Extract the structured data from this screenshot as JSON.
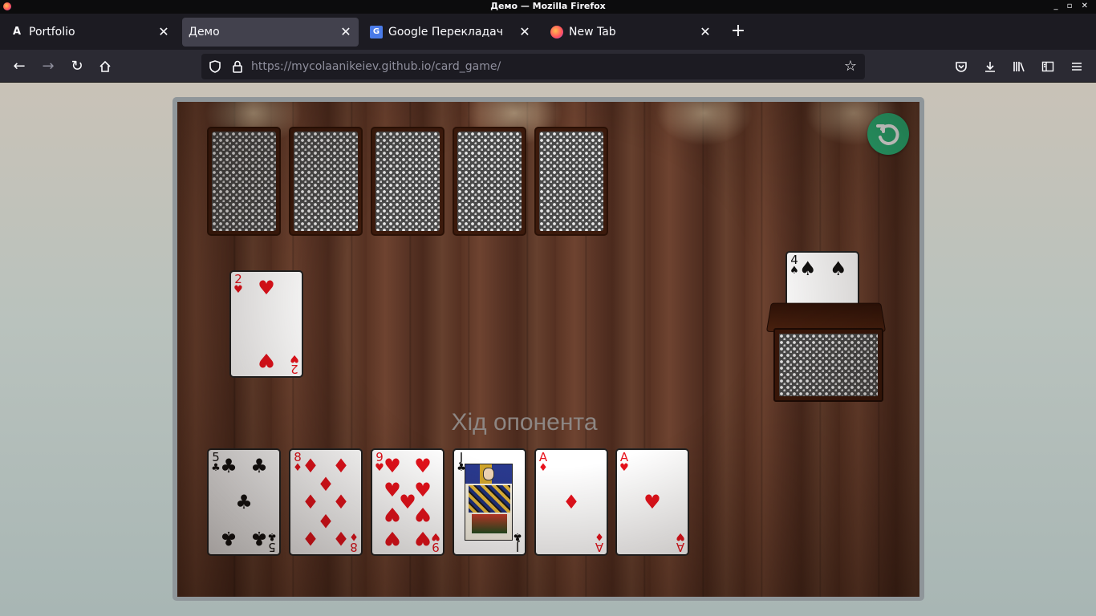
{
  "window": {
    "title": "Демо — Mozilla Firefox",
    "controls": "_ ▫ ✕"
  },
  "tabs": [
    {
      "label": "Portfolio",
      "icon": "a-logo-icon",
      "glyph": "A",
      "active": false
    },
    {
      "label": "Демо",
      "icon": "none",
      "glyph": "",
      "active": true
    },
    {
      "label": "Google Перекладач",
      "icon": "google-translate-icon",
      "glyph": "G",
      "active": false
    },
    {
      "label": "New Tab",
      "icon": "firefox-icon",
      "glyph": "",
      "active": false
    }
  ],
  "navbar": {
    "url_host": "https://mycolaanikeiev.github.io",
    "url_path": "/card_game/"
  },
  "game": {
    "opponent_hand": [
      {
        "face": "down"
      },
      {
        "face": "down"
      },
      {
        "face": "down"
      },
      {
        "face": "down"
      },
      {
        "face": "down"
      }
    ],
    "played_card": {
      "rank": "2",
      "suit": "♥",
      "color": "red"
    },
    "trump_card": {
      "rank": "4",
      "suit": "♠",
      "color": "black"
    },
    "status_text": "Хід опонента",
    "player_hand": [
      {
        "rank": "5",
        "suit": "♣",
        "color": "black"
      },
      {
        "rank": "8",
        "suit": "♦",
        "color": "red"
      },
      {
        "rank": "9",
        "suit": "♥",
        "color": "red"
      },
      {
        "rank": "J",
        "suit": "♣",
        "color": "black"
      },
      {
        "rank": "A",
        "suit": "♦",
        "color": "red"
      },
      {
        "rank": "A",
        "suit": "♥",
        "color": "red"
      }
    ],
    "accent_color": "#2ab77a"
  }
}
